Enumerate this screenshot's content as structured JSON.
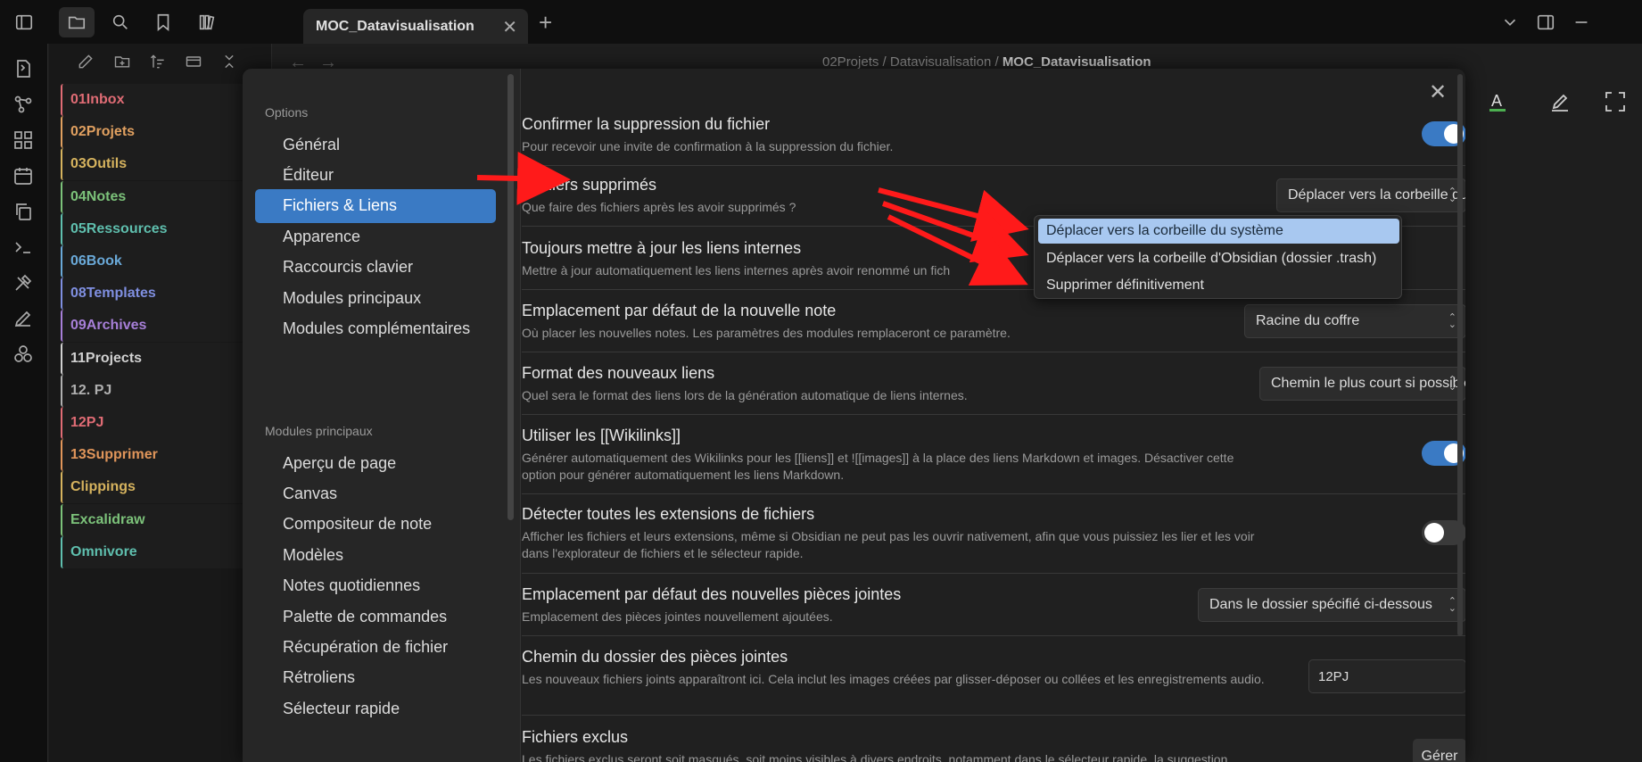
{
  "tab": {
    "title": "MOC_Datavisualisation",
    "close_icon": "close-icon",
    "new_tab_icon": "plus-icon"
  },
  "breadcrumb": {
    "part1": "02Projets",
    "sep1": "/",
    "part2": "Datavisualisation",
    "sep2": "/",
    "current": "MOC_Datavisualisation"
  },
  "explorer": {
    "folders": [
      {
        "name": "01Inbox",
        "color": "#e06c75"
      },
      {
        "name": "02Projets",
        "color": "#e0a060"
      },
      {
        "name": "03Outils",
        "color": "#d6b35e"
      },
      {
        "name": "04Notes",
        "color": "#7cc27a"
      },
      {
        "name": "05Ressources",
        "color": "#5fbfae"
      },
      {
        "name": "06Book",
        "color": "#6aa9d8"
      },
      {
        "name": "08Templates",
        "color": "#7f8fe0"
      },
      {
        "name": "09Archives",
        "color": "#a77fd8"
      },
      {
        "name": "11Projects",
        "color": "#d0d0d0"
      },
      {
        "name": "12. PJ",
        "color": "#b0b0b0"
      },
      {
        "name": "12PJ",
        "color": "#e06c75"
      },
      {
        "name": "13Supprimer",
        "color": "#e0955a"
      },
      {
        "name": "Clippings",
        "color": "#d6b35e"
      },
      {
        "name": "Excalidraw",
        "color": "#7cc27a"
      },
      {
        "name": "Omnivore",
        "color": "#5fbfae"
      }
    ]
  },
  "settings_sidebar": {
    "options_heading": "Options",
    "options": [
      "Général",
      "Éditeur",
      "Fichiers & Liens",
      "Apparence",
      "Raccourcis clavier",
      "Modules principaux",
      "Modules complémentaires"
    ],
    "active_index": 2,
    "modules_heading": "Modules principaux",
    "modules": [
      "Aperçu de page",
      "Canvas",
      "Compositeur de note",
      "Modèles",
      "Notes quotidiennes",
      "Palette de commandes",
      "Récupération de fichier",
      "Rétroliens",
      "Sélecteur rapide"
    ]
  },
  "settings": {
    "confirm_delete": {
      "title": "Confirmer la suppression du fichier",
      "desc": "Pour recevoir une invite de confirmation à la suppression du fichier.",
      "enabled": true
    },
    "deleted_files": {
      "title": "Fichiers supprimés",
      "desc": "Que faire des fichiers après les avoir supprimés ?",
      "value": "Déplacer vers la corbeille du système",
      "options": [
        "Déplacer vers la corbeille du système",
        "Déplacer vers la corbeille d'Obsidian (dossier .trash)",
        "Supprimer définitivement"
      ],
      "selected_index": 0
    },
    "update_links": {
      "title": "Toujours mettre à jour les liens internes",
      "desc": "Mettre à jour automatiquement les liens internes après avoir renommé un fich"
    },
    "new_note_location": {
      "title": "Emplacement par défaut de la nouvelle note",
      "desc": "Où placer les nouvelles notes. Les paramètres des modules remplaceront ce paramètre.",
      "value": "Racine du coffre"
    },
    "link_format": {
      "title": "Format des nouveaux liens",
      "desc": "Quel sera le format des liens lors de la génération automatique de liens internes.",
      "value": "Chemin le plus court si possible"
    },
    "wikilinks": {
      "title": "Utiliser les [[Wikilinks]]",
      "desc": "Générer automatiquement des Wikilinks pour les [[liens]] et ![[images]] à la place des liens Markdown et images. Désactiver cette option pour générer automatiquement les liens Markdown.",
      "enabled": true
    },
    "detect_extensions": {
      "title": "Détecter toutes les extensions de fichiers",
      "desc": "Afficher les fichiers et leurs extensions, même si Obsidian ne peut pas les ouvrir nativement, afin que vous puissiez les lier et les voir dans l'explorateur de fichiers et le sélecteur rapide.",
      "enabled": false
    },
    "attachment_location": {
      "title": "Emplacement par défaut des nouvelles pièces jointes",
      "desc": "Emplacement des pièces jointes nouvellement ajoutées.",
      "value": "Dans le dossier spécifié ci-dessous"
    },
    "attachment_folder": {
      "title": "Chemin du dossier des pièces jointes",
      "desc": "Les nouveaux fichiers joints apparaîtront ici. Cela inclut les images créées par glisser-déposer ou collées et les enregistrements audio.",
      "value": "12PJ"
    },
    "excluded_files": {
      "title": "Fichiers exclus",
      "desc": "Les fichiers exclus seront soit masqués, soit moins visibles à divers endroits, notamment dans le sélecteur rapide, la suggestion",
      "button": "Gérer"
    }
  },
  "colors": {
    "accent": "#3a7ac4",
    "annotation_arrow": "#ff1a1a",
    "dropdown_selected": "#a8c8f0"
  }
}
